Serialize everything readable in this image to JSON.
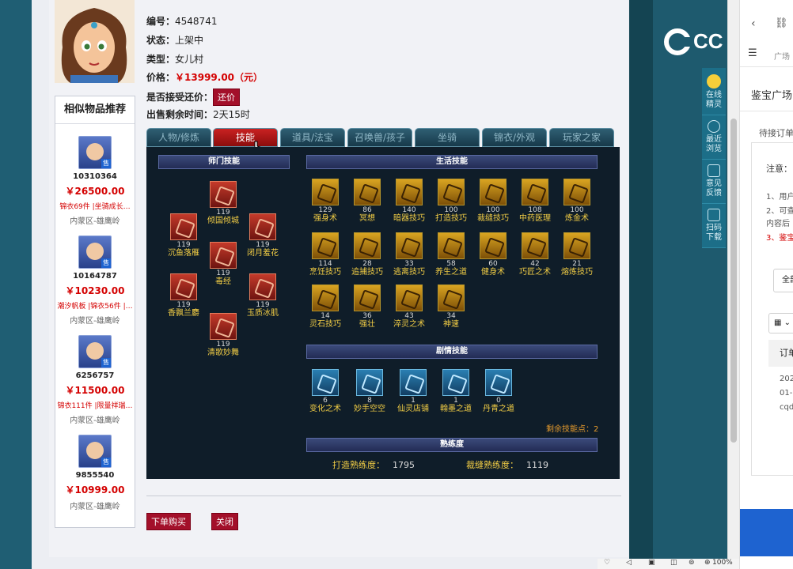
{
  "item": {
    "id_label": "编号：",
    "id_value": "4548741",
    "status_label": "状态：",
    "status_value": "上架中",
    "type_label": "类型：",
    "type_value": "女儿村",
    "price_label": "价格：",
    "price_value": "￥13999.00（元）",
    "bargain_label": "是否接受还价：",
    "bargain_button": "还价",
    "time_label": "出售剩余时间：",
    "time_value": "2天15时"
  },
  "similar": {
    "title": "相似物品推荐",
    "items": [
      {
        "id": "10310364",
        "price": "￥26500.00",
        "tags": "锦衣69件 |坐骑成长…",
        "server": "内蒙区-雄鹰岭",
        "sale": "售"
      },
      {
        "id": "10164787",
        "price": "￥10230.00",
        "tags": "潮汐帆板 |锦衣56件 |…",
        "server": "内蒙区-雄鹰岭",
        "sale": "售"
      },
      {
        "id": "6256757",
        "price": "￥11500.00",
        "tags": "锦衣111件 |限量祥瑞…",
        "server": "内蒙区-雄鹰岭",
        "sale": "售"
      },
      {
        "id": "9855540",
        "price": "￥10999.00",
        "tags": "",
        "server": "内蒙区-雄鹰岭",
        "sale": "售"
      }
    ]
  },
  "tabs": [
    "人物/修炼",
    "技能",
    "道具/法宝",
    "召唤兽/孩子",
    "坐骑",
    "锦衣/外观",
    "玩家之家"
  ],
  "sections": {
    "school": "师门技能",
    "life": "生活技能",
    "plot": "剧情技能",
    "proficiency": "熟练度"
  },
  "school_skills": [
    {
      "name": "倾国倾城",
      "level": "119"
    },
    {
      "name": "沉鱼落雁",
      "level": "119"
    },
    {
      "name": "闭月羞花",
      "level": "119"
    },
    {
      "name": "毒经",
      "level": "119"
    },
    {
      "name": "香飘兰麝",
      "level": "119"
    },
    {
      "name": "玉质冰肌",
      "level": "119"
    },
    {
      "name": "清歌妙舞",
      "level": "119"
    }
  ],
  "life_skills": [
    {
      "name": "强身术",
      "level": "129"
    },
    {
      "name": "冥想",
      "level": "86"
    },
    {
      "name": "暗器技巧",
      "level": "140"
    },
    {
      "name": "打造技巧",
      "level": "100"
    },
    {
      "name": "裁缝技巧",
      "level": "100"
    },
    {
      "name": "中药医理",
      "level": "108"
    },
    {
      "name": "炼金术",
      "level": "100"
    },
    {
      "name": "烹饪技巧",
      "level": "114"
    },
    {
      "name": "追捕技巧",
      "level": "28"
    },
    {
      "name": "逃离技巧",
      "level": "33"
    },
    {
      "name": "养生之道",
      "level": "58"
    },
    {
      "name": "健身术",
      "level": "60"
    },
    {
      "name": "巧匠之术",
      "level": "42"
    },
    {
      "name": "熔炼技巧",
      "level": "21"
    },
    {
      "name": "灵石技巧",
      "level": "14"
    },
    {
      "name": "强壮",
      "level": "36"
    },
    {
      "name": "淬灵之术",
      "level": "43"
    },
    {
      "name": "神速",
      "level": "34"
    }
  ],
  "plot_skills": [
    {
      "name": "变化之术",
      "level": "6"
    },
    {
      "name": "妙手空空",
      "level": "8"
    },
    {
      "name": "仙灵店铺",
      "level": "1"
    },
    {
      "name": "翰墨之道",
      "level": "1"
    },
    {
      "name": "丹青之道",
      "level": "0"
    }
  ],
  "remaining_points": "剩余技能点：2",
  "proficiency": {
    "forge_label": "打造熟练度：",
    "forge_value": "1795",
    "tailor_label": "裁缝熟练度：",
    "tailor_value": "1119"
  },
  "actions": {
    "buy": "下单购买",
    "close": "关闭"
  },
  "sidebar": [
    {
      "label": "在线精灵"
    },
    {
      "label": "最近浏览"
    },
    {
      "label": "意见反馈"
    },
    {
      "label": "扫码下载"
    }
  ],
  "right": {
    "square_tab": "广场",
    "title": "鉴宝广场",
    "pending": "待接订单",
    "note": "注意：",
    "line1": "1、用户",
    "line2": "2、可查",
    "line3": "内容后",
    "line4": "3、鉴宝",
    "all_label": "全部",
    "order_header": "订单",
    "order_year": "202",
    "order_date": "01-",
    "order_code": "cqd"
  },
  "status_zoom": "100%",
  "logo": "CC"
}
